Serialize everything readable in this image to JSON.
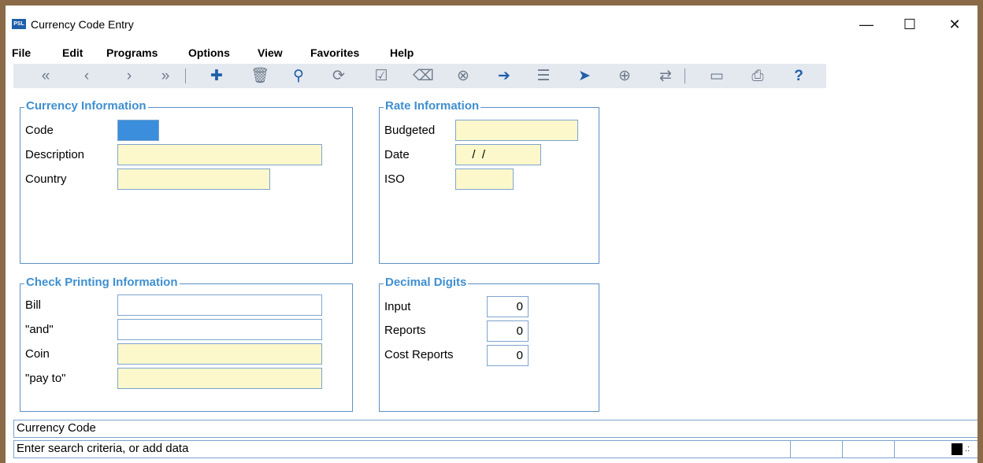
{
  "window": {
    "title": "Currency Code Entry",
    "app_icon_text": "PSL",
    "controls": {
      "minimize": "—",
      "maximize": "☐",
      "close": "✕"
    }
  },
  "menu": [
    "File",
    "Edit",
    "Programs",
    "Options",
    "View",
    "Favorites",
    "Help"
  ],
  "toolbar": [
    {
      "name": "first-record-icon",
      "glyph": "«"
    },
    {
      "name": "previous-record-icon",
      "glyph": "‹"
    },
    {
      "name": "next-record-icon",
      "glyph": "›"
    },
    {
      "name": "last-record-icon",
      "glyph": "»"
    },
    {
      "name": "add-icon",
      "glyph": "✚"
    },
    {
      "name": "delete-icon",
      "glyph": "🗑"
    },
    {
      "name": "search-icon",
      "glyph": "⚲"
    },
    {
      "name": "refresh-icon",
      "glyph": "⟳"
    },
    {
      "name": "save-check-icon",
      "glyph": "☑"
    },
    {
      "name": "eraser-icon",
      "glyph": "⌫"
    },
    {
      "name": "cancel-icon",
      "glyph": "⊗"
    },
    {
      "name": "exit-icon",
      "glyph": "➔"
    },
    {
      "name": "list-icon",
      "glyph": "☰"
    },
    {
      "name": "pointer-icon",
      "glyph": "➤"
    },
    {
      "name": "zoom-icon",
      "glyph": "⊕"
    },
    {
      "name": "swap-icon",
      "glyph": "⇄"
    },
    {
      "name": "note-icon",
      "glyph": "▭"
    },
    {
      "name": "print-icon",
      "glyph": "⎙"
    },
    {
      "name": "help-icon",
      "glyph": "?"
    }
  ],
  "currency_info": {
    "title": "Currency Information",
    "code_label": "Code",
    "code_value": "",
    "description_label": "Description",
    "description_value": "",
    "country_label": "Country",
    "country_value": ""
  },
  "rate_info": {
    "title": "Rate Information",
    "budgeted_label": "Budgeted",
    "budgeted_value": "",
    "date_label": "Date",
    "date_value": "  /  /",
    "iso_label": "ISO",
    "iso_value": ""
  },
  "check_info": {
    "title": "Check Printing Information",
    "bill_label": "Bill",
    "bill_value": "",
    "and_label": "\"and\"",
    "and_value": "",
    "coin_label": "Coin",
    "coin_value": "",
    "payto_label": "\"pay to\"",
    "payto_value": ""
  },
  "decimal_digits": {
    "title": "Decimal Digits",
    "input_label": "Input",
    "input_value": "0",
    "reports_label": "Reports",
    "reports_value": "0",
    "cost_reports_label": "Cost Reports",
    "cost_reports_value": "0"
  },
  "status": {
    "field_name": "Currency Code",
    "message": "Enter search criteria, or add data"
  }
}
